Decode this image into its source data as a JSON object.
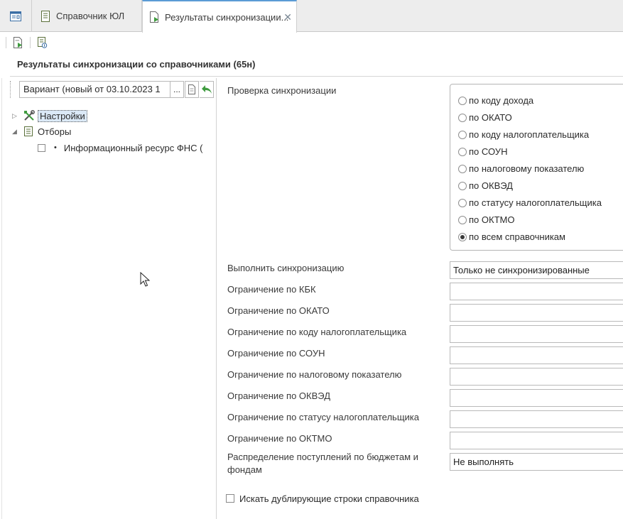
{
  "tabs": [
    {
      "label": ""
    },
    {
      "label": "Справочник ЮЛ"
    },
    {
      "label": "Результаты синхронизации..."
    }
  ],
  "page_title": "Результаты синхронизации со справочниками (65н)",
  "variant": {
    "value": "Вариант (новый от 03.10.2023 1",
    "more_label": "..."
  },
  "tree": {
    "settings": "Настройки",
    "filters": "Отборы",
    "filter_item": "Информационный ресурс ФНС ("
  },
  "sync_check": {
    "label": "Проверка синхронизации",
    "options": [
      "по коду дохода",
      "по ОКАТО",
      "по коду налогоплательщика",
      "по СОУН",
      "по налоговому показателю",
      "по ОКВЭД",
      "по статусу налогоплательщика",
      "по ОКТМО",
      "по всем справочникам"
    ],
    "selected_index": 8
  },
  "form": {
    "run_sync_label": "Выполнить синхронизацию",
    "run_sync_value": "Только не синхронизированные",
    "kbk_label": "Ограничение по КБК",
    "okato_label": "Ограничение по ОКАТО",
    "taxpayer_code_label": "Ограничение по коду налогоплательщика",
    "soun_label": "Ограничение по СОУН",
    "tax_indicator_label": "Ограничение по налоговому показателю",
    "okved_label": "Ограничение по ОКВЭД",
    "taxpayer_status_label": "Ограничение по статусу налогоплательщика",
    "oktmo_label": "Ограничение по ОКТМО",
    "distribution_label_line1": "Распределение поступлений по бюджетам и",
    "distribution_label_line2": "фондам",
    "distribution_value": "Не выполнять",
    "duplicates_label": "Искать дублирующие строки справочника"
  },
  "colors": {
    "accent": "#5b9bd5",
    "selection": "#dbe9f7",
    "green_arrow": "#3f9b3f"
  }
}
